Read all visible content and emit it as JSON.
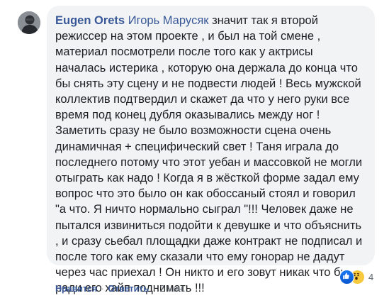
{
  "comment": {
    "author": "Eugen Orets",
    "mention": "Игорь Маруcяк",
    "text": " значит так я второй режиссер на этом проекте , и был на той смене , материал посмотрели после того как у актрисы началась истерика , которую она держала до конца что бы снять эту сцену и не подвести людей ! Весь мужской коллектив подтвердил и скажет да что у него руки все время под конец дубля оказывались между ног ! Заметить сразу не было возможности сцена очень динамичная + специфический свет ! Таня играла до последнего потому что этот уебан и массовкой не могли отыграть как надо ! Когда я в жёсткой форме задал ему вопрос что это было он как обоссаный стоял и говорил \"а что. Я ничто нормально сыграл \"!!! Человек даже не пытался извиниться подойти к девушке и что объяснить , и сразу сьебал площадки даже контракт не подписал и после того как ему сказали что ему гонорар не дадут через час приехал ! Он никто и его зовут никак что бы ради его хайп поднимать !!!"
  },
  "reactions": {
    "icons": [
      "like-icon",
      "wow-icon"
    ],
    "count": "4"
  },
  "actions": {
    "like": "Нравится",
    "reply": "Ответить",
    "time": "2 мин.",
    "separator": "·"
  },
  "colors": {
    "link": "#385898",
    "bubble": "#f2f3f5",
    "text": "#1c1e21",
    "meta": "#606770"
  }
}
